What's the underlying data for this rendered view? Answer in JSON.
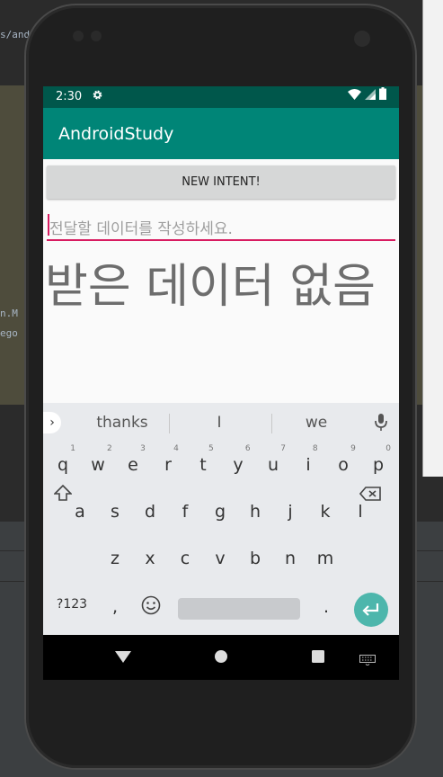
{
  "ide": {
    "snippet_top": "s/and",
    "snippet_mid1": "n.M",
    "snippet_mid2": "ego"
  },
  "status_bar": {
    "time": "2:30",
    "icons": [
      "settings-icon",
      "wifi-icon",
      "signal-icon",
      "battery-icon"
    ]
  },
  "app_bar": {
    "title": "AndroidStudy"
  },
  "main": {
    "button_label": "NEW INTENT!",
    "input_placeholder": "전달할 데이터를 작성하세요.",
    "received_text": "받은 데이터 없음"
  },
  "keyboard": {
    "suggestions": [
      "thanks",
      "I",
      "we"
    ],
    "row1": [
      {
        "key": "q",
        "hint": "1"
      },
      {
        "key": "w",
        "hint": "2"
      },
      {
        "key": "e",
        "hint": "3"
      },
      {
        "key": "r",
        "hint": "4"
      },
      {
        "key": "t",
        "hint": "5"
      },
      {
        "key": "y",
        "hint": "6"
      },
      {
        "key": "u",
        "hint": "7"
      },
      {
        "key": "i",
        "hint": "8"
      },
      {
        "key": "o",
        "hint": "9"
      },
      {
        "key": "p",
        "hint": "0"
      }
    ],
    "row2": [
      "a",
      "s",
      "d",
      "f",
      "g",
      "h",
      "j",
      "k",
      "l"
    ],
    "row3": [
      "z",
      "x",
      "c",
      "v",
      "b",
      "n",
      "m"
    ],
    "symbols_label": "?123",
    "comma": ",",
    "period": "."
  },
  "colors": {
    "status_bar": "#00574b",
    "app_bar": "#008577",
    "accent": "#d81b60",
    "enter_key": "#4db6ac"
  }
}
